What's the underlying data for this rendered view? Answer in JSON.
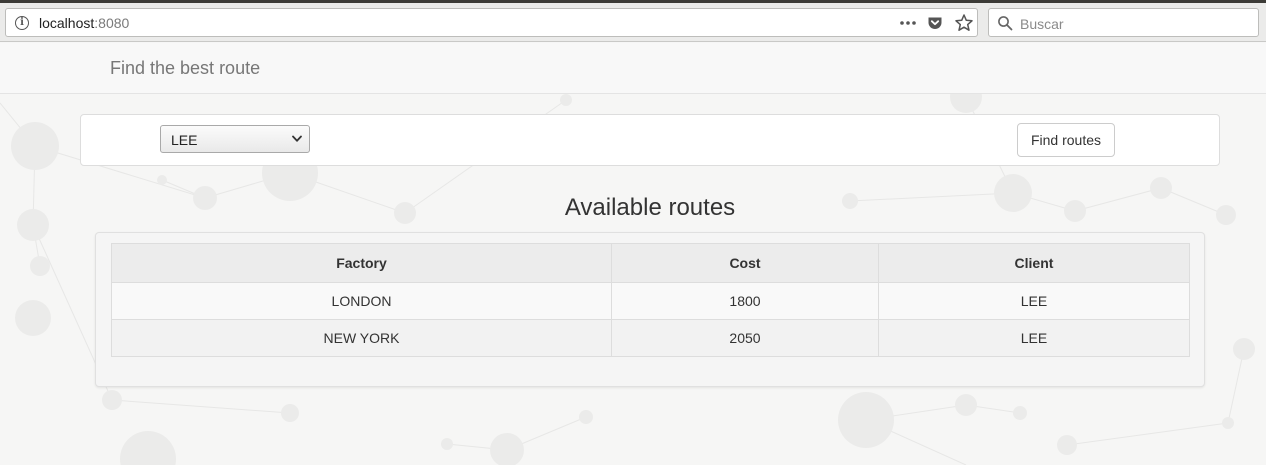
{
  "browser": {
    "url_host": "localhost",
    "url_port": ":8080",
    "search_placeholder": "Buscar"
  },
  "navbar": {
    "brand": "Find the best route"
  },
  "form": {
    "client_selected": "LEE",
    "find_button": "Find routes"
  },
  "routes": {
    "title": "Available routes",
    "columns": [
      "Factory",
      "Cost",
      "Client"
    ],
    "rows": [
      [
        "LONDON",
        "1800",
        "LEE"
      ],
      [
        "NEW YORK",
        "2050",
        "LEE"
      ]
    ]
  }
}
